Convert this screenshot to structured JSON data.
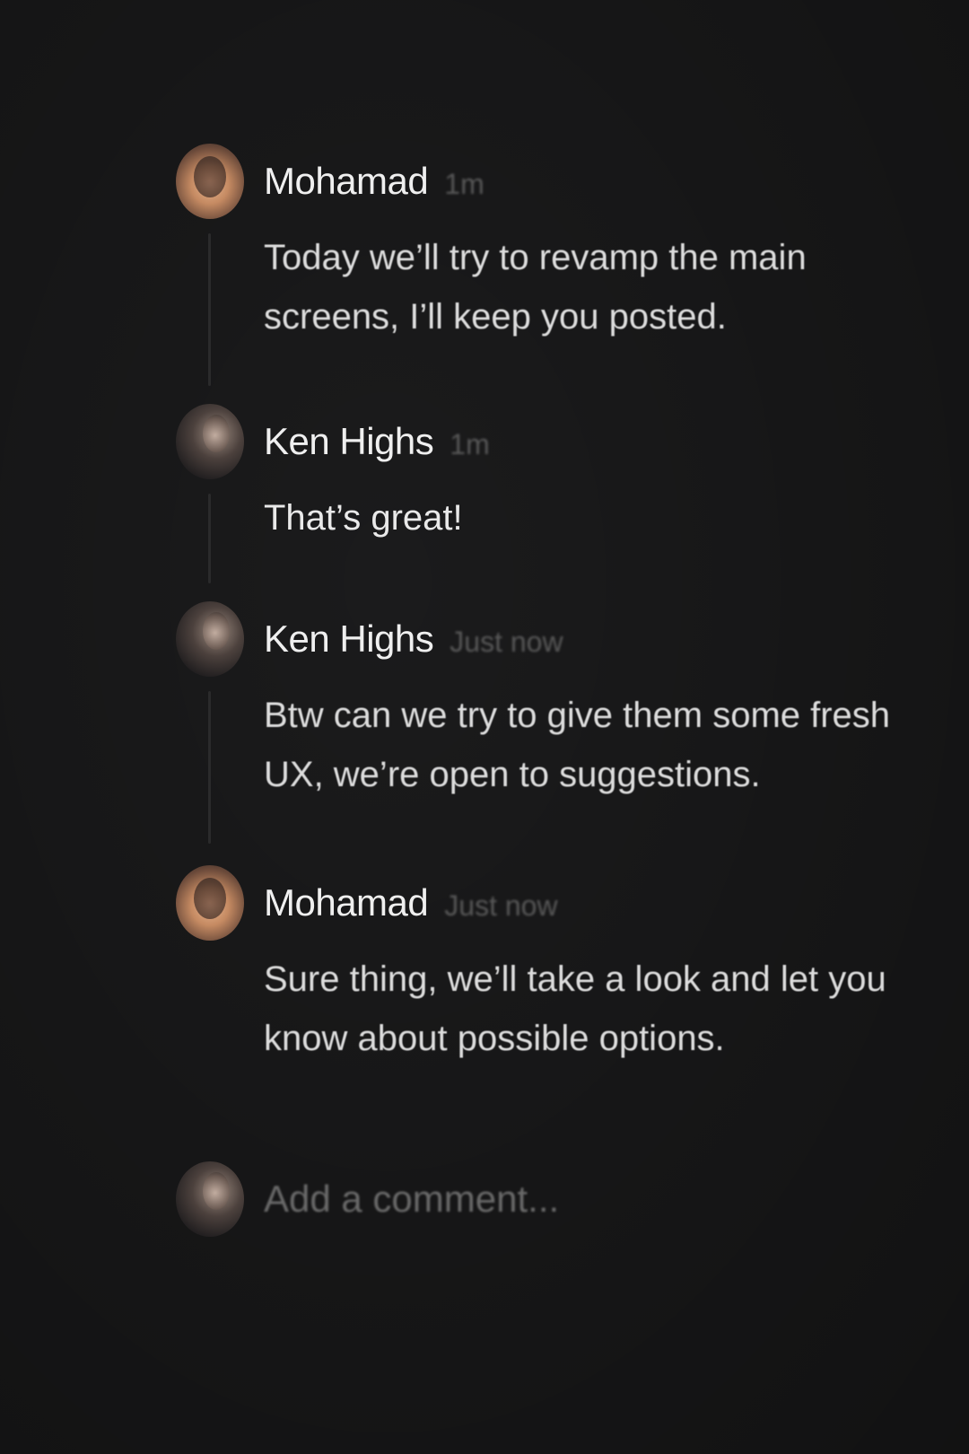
{
  "thread": {
    "comments": [
      {
        "author": "Mohamad",
        "time": "1m",
        "lines": [
          "Today we’ll try to revamp the main",
          "screens, I’ll keep you posted."
        ],
        "avatar": "avatar-mohamad"
      },
      {
        "author": "Ken Highs",
        "time": "1m",
        "lines": [
          "That’s great!"
        ],
        "avatar": "avatar-ken"
      },
      {
        "author": "Ken Highs",
        "time": "Just now",
        "lines": [
          "Btw can we try to give them some fresh",
          "UX, we’re open to suggestions."
        ],
        "avatar": "avatar-ken"
      },
      {
        "author": "Mohamad",
        "time": "Just now",
        "lines": [
          "Sure thing, we’ll take a look and let you",
          "know about possible options."
        ],
        "avatar": "avatar-mohamad"
      }
    ]
  },
  "composer": {
    "placeholder": "Add a comment...",
    "avatar": "avatar-ken"
  },
  "colors": {
    "background": "#1b1b1c",
    "author_text": "#efefef",
    "timestamp_text": "#595959",
    "body_text": "#e9e9e9",
    "placeholder_text": "#6a6a6a",
    "thread_line": "#2a2a2b"
  }
}
